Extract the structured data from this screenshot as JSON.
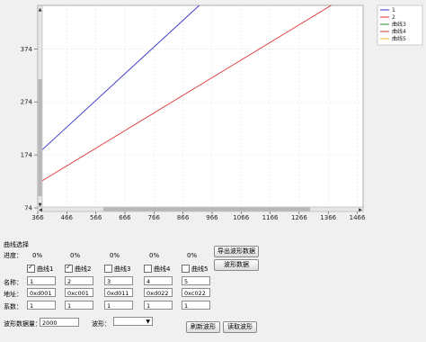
{
  "chart_data": {
    "type": "line",
    "x_ticks": [
      "366",
      "466",
      "566",
      "666",
      "766",
      "866",
      "966",
      "1066",
      "1166",
      "1266",
      "1366",
      "1466"
    ],
    "y_ticks": [
      "374",
      "274",
      "174",
      "74"
    ],
    "xlim": [
      366,
      1486
    ],
    "ylim": [
      74,
      456
    ],
    "series": [
      {
        "name": "1",
        "color": "#3333cc",
        "x": [
          366,
          922
        ],
        "y": [
          176,
          456
        ]
      },
      {
        "name": "2",
        "color": "#e03030",
        "x": [
          366,
          1376
        ],
        "y": [
          120,
          456
        ]
      },
      {
        "name": "曲线3",
        "color": "#228b22",
        "x": [],
        "y": []
      },
      {
        "name": "曲线4",
        "color": "#c0392b",
        "x": [],
        "y": []
      },
      {
        "name": "曲线5",
        "color": "#f0b020",
        "x": [],
        "y": []
      }
    ]
  },
  "panel": {
    "title": "曲线选择",
    "progress_label": "进度：",
    "name_label": "名称：",
    "address_label": "地址：",
    "coef_label": "系数：",
    "count_label": "波形数据量：",
    "count_value": "2000",
    "wave_label": "波形：",
    "wave_value": "",
    "curves": [
      {
        "percent": "0%",
        "checked": true,
        "label": "曲线1",
        "name": "1",
        "address": "0xd001",
        "coef": "1"
      },
      {
        "percent": "0%",
        "checked": true,
        "label": "曲线2",
        "name": "2",
        "address": "0xc001",
        "coef": "1"
      },
      {
        "percent": "0%",
        "checked": false,
        "label": "曲线3",
        "name": "3",
        "address": "0xd011",
        "coef": "1"
      },
      {
        "percent": "0%",
        "checked": false,
        "label": "曲线4",
        "name": "4",
        "address": "0xd022",
        "coef": "1"
      },
      {
        "percent": "0%",
        "checked": false,
        "label": "曲线5",
        "name": "5",
        "address": "0xc022",
        "coef": "1"
      }
    ],
    "buttons": {
      "export": "导出波形数据",
      "wave_data": "波形数据",
      "refresh": "刷新波形",
      "read": "读取波形"
    }
  }
}
